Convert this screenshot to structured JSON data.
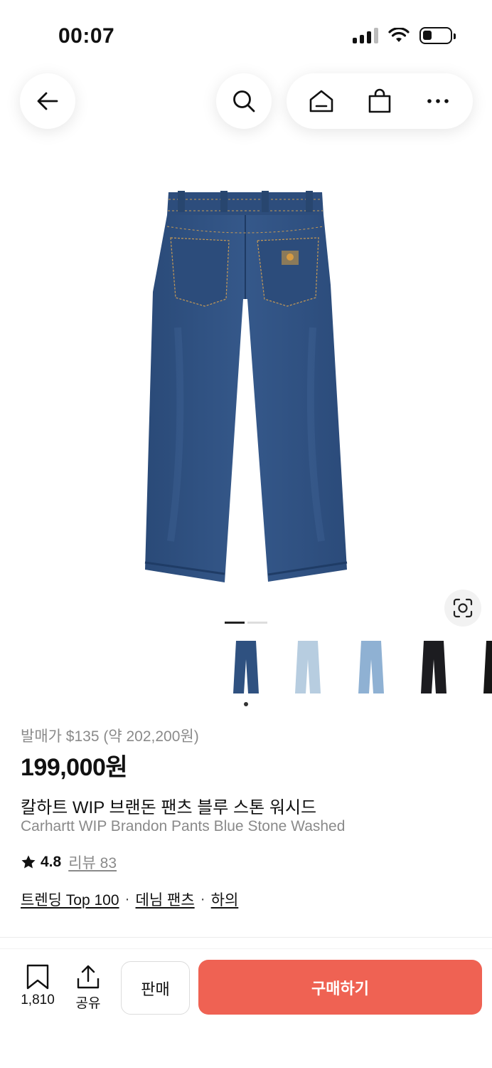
{
  "status_bar": {
    "time": "00:07"
  },
  "nav": {
    "back_icon": "arrow-left-icon",
    "search_icon": "search-icon",
    "home_icon": "home-icon",
    "cart_icon": "shopping-bag-icon",
    "more_icon": "more-horizontal-icon"
  },
  "gallery": {
    "current_page": 1,
    "total_pages": 2
  },
  "variants": {
    "selected_index": 0,
    "colors": [
      "#2f5180",
      "#b7cde0",
      "#8fb1d3",
      "#1c1c20",
      "#161616"
    ]
  },
  "product": {
    "release_price": "발매가 $135 (약 202,200원)",
    "price": "199,000원",
    "title_ko": "칼하트 WIP 브랜돈 팬츠 블루 스톤 워시드",
    "title_en": "Carhartt WIP Brandon Pants Blue Stone Washed",
    "rating": "4.8",
    "review_label": "리뷰 83",
    "categories": [
      "트렌딩 Top 100",
      "데님 팬츠",
      "하의"
    ],
    "category_separator": "·"
  },
  "bottom_bar": {
    "bookmark_count": "1,810",
    "share_label": "공유",
    "sell_label": "판매",
    "buy_label": "구매하기"
  },
  "colors": {
    "accent": "#ef6253",
    "denim": "#2f5180",
    "muted_text": "#8a8a8a"
  }
}
